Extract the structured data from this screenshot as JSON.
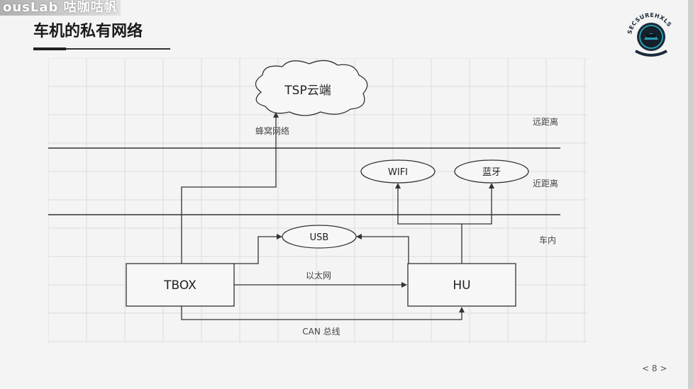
{
  "watermark": "ousLab 咕咖咕帆",
  "slide": {
    "title": "车机的私有网络",
    "page_number": "< 8 >"
  },
  "logo": {
    "ring_text": "SECSUREHXLS"
  },
  "diagram": {
    "cloud_label": "TSP云端",
    "cellular_label": "蜂窝网络",
    "zones": [
      "远距离",
      "近距离",
      "车内"
    ],
    "wifi_label": "WIFI",
    "bluetooth_label": "蓝牙",
    "usb_label": "USB",
    "tbox_label": "TBOX",
    "hu_label": "HU",
    "ethernet_label": "以太网",
    "can_label": "CAN 总线"
  },
  "colors": {
    "background": "#f4f4f4",
    "grid": "#dcdcdc",
    "line": "#333333",
    "logo_dark": "#1d2a3a",
    "logo_accent": "#2bb7c8"
  }
}
